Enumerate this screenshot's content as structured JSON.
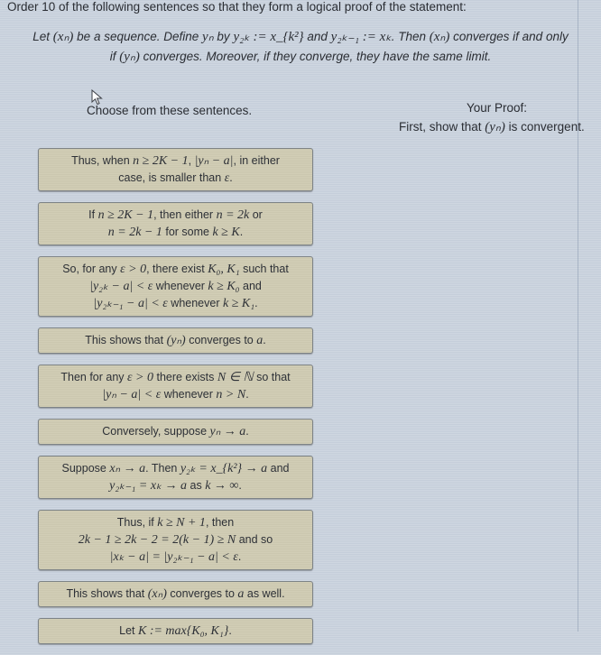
{
  "instruction": "Order 10 of the following sentences so that they form a logical proof of the statement:",
  "statement": {
    "line1_a": "Let ",
    "xn": "(xₙ)",
    "line1_b": " be a sequence. Define ",
    "yn": "yₙ",
    "line1_c": " by ",
    "def1": "y₂ₖ := x_{k²}",
    "line1_d": " and ",
    "def2": "y₂ₖ₋₁ := xₖ",
    "line1_e": ". Then ",
    "xn2": "(xₙ)",
    "line1_f": " converges if and only",
    "line2_a": "if ",
    "yn2": "(yₙ)",
    "line2_b": " converges. Moreover, if they converge, they have the same limit."
  },
  "choices_panel": {
    "label": "Choose from these sentences.",
    "cursor_icon": "arrow-cursor-icon"
  },
  "proof_panel": {
    "title": "Your Proof:",
    "first_a": "First, show that ",
    "first_math": "(yₙ)",
    "first_b": " is convergent."
  },
  "cards": [
    {
      "lines": [
        [
          "Thus, when ",
          "n ≥ 2K − 1",
          ", ",
          "|yₙ − a|",
          ", in either"
        ],
        [
          "case, is smaller than ",
          "ε",
          "."
        ]
      ]
    },
    {
      "lines": [
        [
          "If ",
          "n ≥ 2K − 1",
          ", then either ",
          "n = 2k",
          " or"
        ],
        [
          "",
          "n = 2k − 1",
          " for some ",
          "k ≥ K",
          "."
        ]
      ]
    },
    {
      "lines": [
        [
          "So, for any ",
          "ε > 0",
          ", there exist ",
          "K₀, K₁",
          " such that"
        ],
        [
          "",
          "|y₂ₖ − a| < ε",
          " whenever ",
          "k ≥ K₀",
          " and"
        ],
        [
          "",
          "|y₂ₖ₋₁ − a| < ε",
          " whenever ",
          "k ≥ K₁",
          "."
        ]
      ]
    },
    {
      "lines": [
        [
          "This shows that ",
          "(yₙ)",
          " converges to ",
          "a",
          "."
        ]
      ]
    },
    {
      "lines": [
        [
          "Then for any ",
          "ε > 0",
          " there exists ",
          "N ∈ ℕ",
          " so that"
        ],
        [
          "",
          "|yₙ − a| < ε",
          " whenever ",
          "n > N",
          "."
        ]
      ]
    },
    {
      "lines": [
        [
          "Conversely, suppose ",
          "yₙ → a",
          "."
        ]
      ]
    },
    {
      "lines": [
        [
          "Suppose ",
          "xₙ → a",
          ". Then ",
          "y₂ₖ = x_{k²} → a",
          " and"
        ],
        [
          "",
          "y₂ₖ₋₁ = xₖ → a",
          " as ",
          "k → ∞",
          "."
        ]
      ]
    },
    {
      "lines": [
        [
          "Thus, if ",
          "k ≥ N + 1",
          ", then"
        ],
        [
          "",
          "2k − 1 ≥ 2k − 2 = 2(k − 1) ≥ N",
          " and so"
        ],
        [
          "",
          "|xₖ − a| = |y₂ₖ₋₁ − a| < ε",
          "."
        ]
      ]
    },
    {
      "lines": [
        [
          "This shows that ",
          "(xₙ)",
          " converges to ",
          "a",
          " as well."
        ]
      ]
    },
    {
      "lines": [
        [
          "Let ",
          "K := max{K₀, K₁}",
          "."
        ]
      ]
    }
  ],
  "colors": {
    "background": "#c9d2de",
    "card_fill": "#cfcbb2",
    "card_border": "#7d8386",
    "text": "#2a2d33"
  }
}
